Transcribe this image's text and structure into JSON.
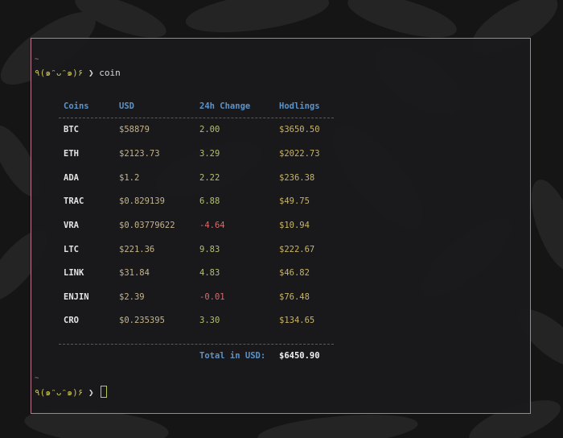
{
  "terminal": {
    "prompt_tilde": "~",
    "prompt_kaomoji": "٩(๑ᵔᴗᵔ๑)۶",
    "prompt_arrow": "❯",
    "command": "coin"
  },
  "table": {
    "headers": [
      "Coins",
      "USD",
      "24h Change",
      "Hodlings"
    ],
    "rows": [
      {
        "coin": "BTC",
        "usd": "$58879",
        "change": "2.00",
        "hodlings": "$3650.50"
      },
      {
        "coin": "ETH",
        "usd": "$2123.73",
        "change": "3.29",
        "hodlings": "$2022.73"
      },
      {
        "coin": "ADA",
        "usd": "$1.2",
        "change": "2.22",
        "hodlings": "$236.38"
      },
      {
        "coin": "TRAC",
        "usd": "$0.829139",
        "change": "6.88",
        "hodlings": "$49.75"
      },
      {
        "coin": "VRA",
        "usd": "$0.03779622",
        "change": "-4.64",
        "hodlings": "$10.94"
      },
      {
        "coin": "LTC",
        "usd": "$221.36",
        "change": "9.83",
        "hodlings": "$222.67"
      },
      {
        "coin": "LINK",
        "usd": "$31.84",
        "change": "4.83",
        "hodlings": "$46.82"
      },
      {
        "coin": "ENJIN",
        "usd": "$2.39",
        "change": "-0.01",
        "hodlings": "$76.48"
      },
      {
        "coin": "CRO",
        "usd": "$0.235395",
        "change": "3.30",
        "hodlings": "$134.65"
      }
    ],
    "total_label": "Total in USD:",
    "total_value": "$6450.90"
  },
  "colors": {
    "header": "#5d93c8",
    "positive": "#b4c070",
    "negative": "#d76b6b",
    "border": "#b9788f"
  }
}
